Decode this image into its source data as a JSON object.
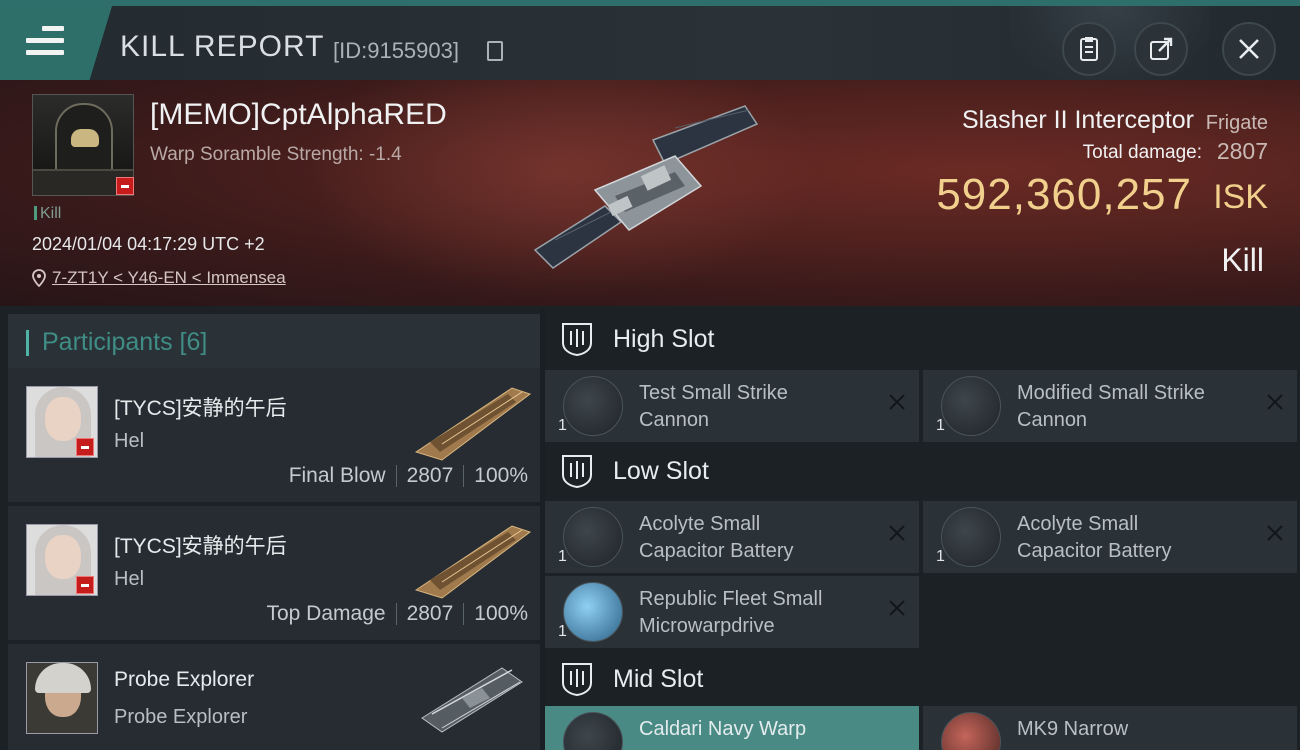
{
  "header": {
    "title": "KILL REPORT",
    "report_id": "[ID:9155903]"
  },
  "victim": {
    "name": "[MEMO]CptAlphaRED",
    "warp_strength": "Warp Soramble Strength: -1.4",
    "kill_tag": "Kill",
    "date": "2024/01/04 04:17:29 UTC +2",
    "location": "7-ZT1Y < Y46-EN < Immensea",
    "ship_name": "Slasher II Interceptor",
    "ship_class": "Frigate",
    "total_damage_label": "Total damage:",
    "total_damage": "2807",
    "isk_value": "592,360,257",
    "isk_unit": "ISK",
    "result": "Kill"
  },
  "participants": {
    "title": "Participants [6]",
    "items": [
      {
        "name": "[TYCS]安静的午后",
        "corp": "Hel",
        "role": "Final Blow",
        "damage": "2807",
        "percent": "100%"
      },
      {
        "name": "[TYCS]安静的午后",
        "corp": "Hel",
        "role": "Top Damage",
        "damage": "2807",
        "percent": "100%"
      },
      {
        "name": "Probe Explorer",
        "corp": "Probe Explorer"
      }
    ]
  },
  "fittings": {
    "high_slot": {
      "title": "High Slot",
      "modules": [
        {
          "name_line1": "Test Small Strike",
          "name_line2": "Cannon",
          "qty": "1"
        },
        {
          "name_line1": "Modified Small Strike",
          "name_line2": "Cannon",
          "qty": "1"
        }
      ]
    },
    "low_slot": {
      "title": "Low Slot",
      "modules": [
        {
          "name_line1": "Acolyte Small",
          "name_line2": "Capacitor Battery",
          "qty": "1"
        },
        {
          "name_line1": "Acolyte Small",
          "name_line2": "Capacitor Battery",
          "qty": "1"
        },
        {
          "name_line1": "Republic Fleet Small",
          "name_line2": "Microwarpdrive",
          "qty": "1"
        }
      ]
    },
    "mid_slot": {
      "title": "Mid Slot",
      "modules": [
        {
          "name_line1": "Caldari Navy Warp"
        },
        {
          "name_line1": "MK9 Narrow"
        }
      ]
    }
  },
  "icons": {
    "menu": "hamburger-icon",
    "copy": "copy-icon",
    "clipboard": "clipboard-icon",
    "share": "share-icon",
    "close": "close-icon",
    "pin": "location-pin-icon",
    "slot": "slot-shield-icon",
    "remove": "remove-x-icon"
  },
  "colors": {
    "accent_teal": "#2f6f6b",
    "isk_gold": "#f1cf8c",
    "banner_red": "#52221f",
    "participants_title": "#3f8d85",
    "minus_badge": "#c51c1c"
  }
}
